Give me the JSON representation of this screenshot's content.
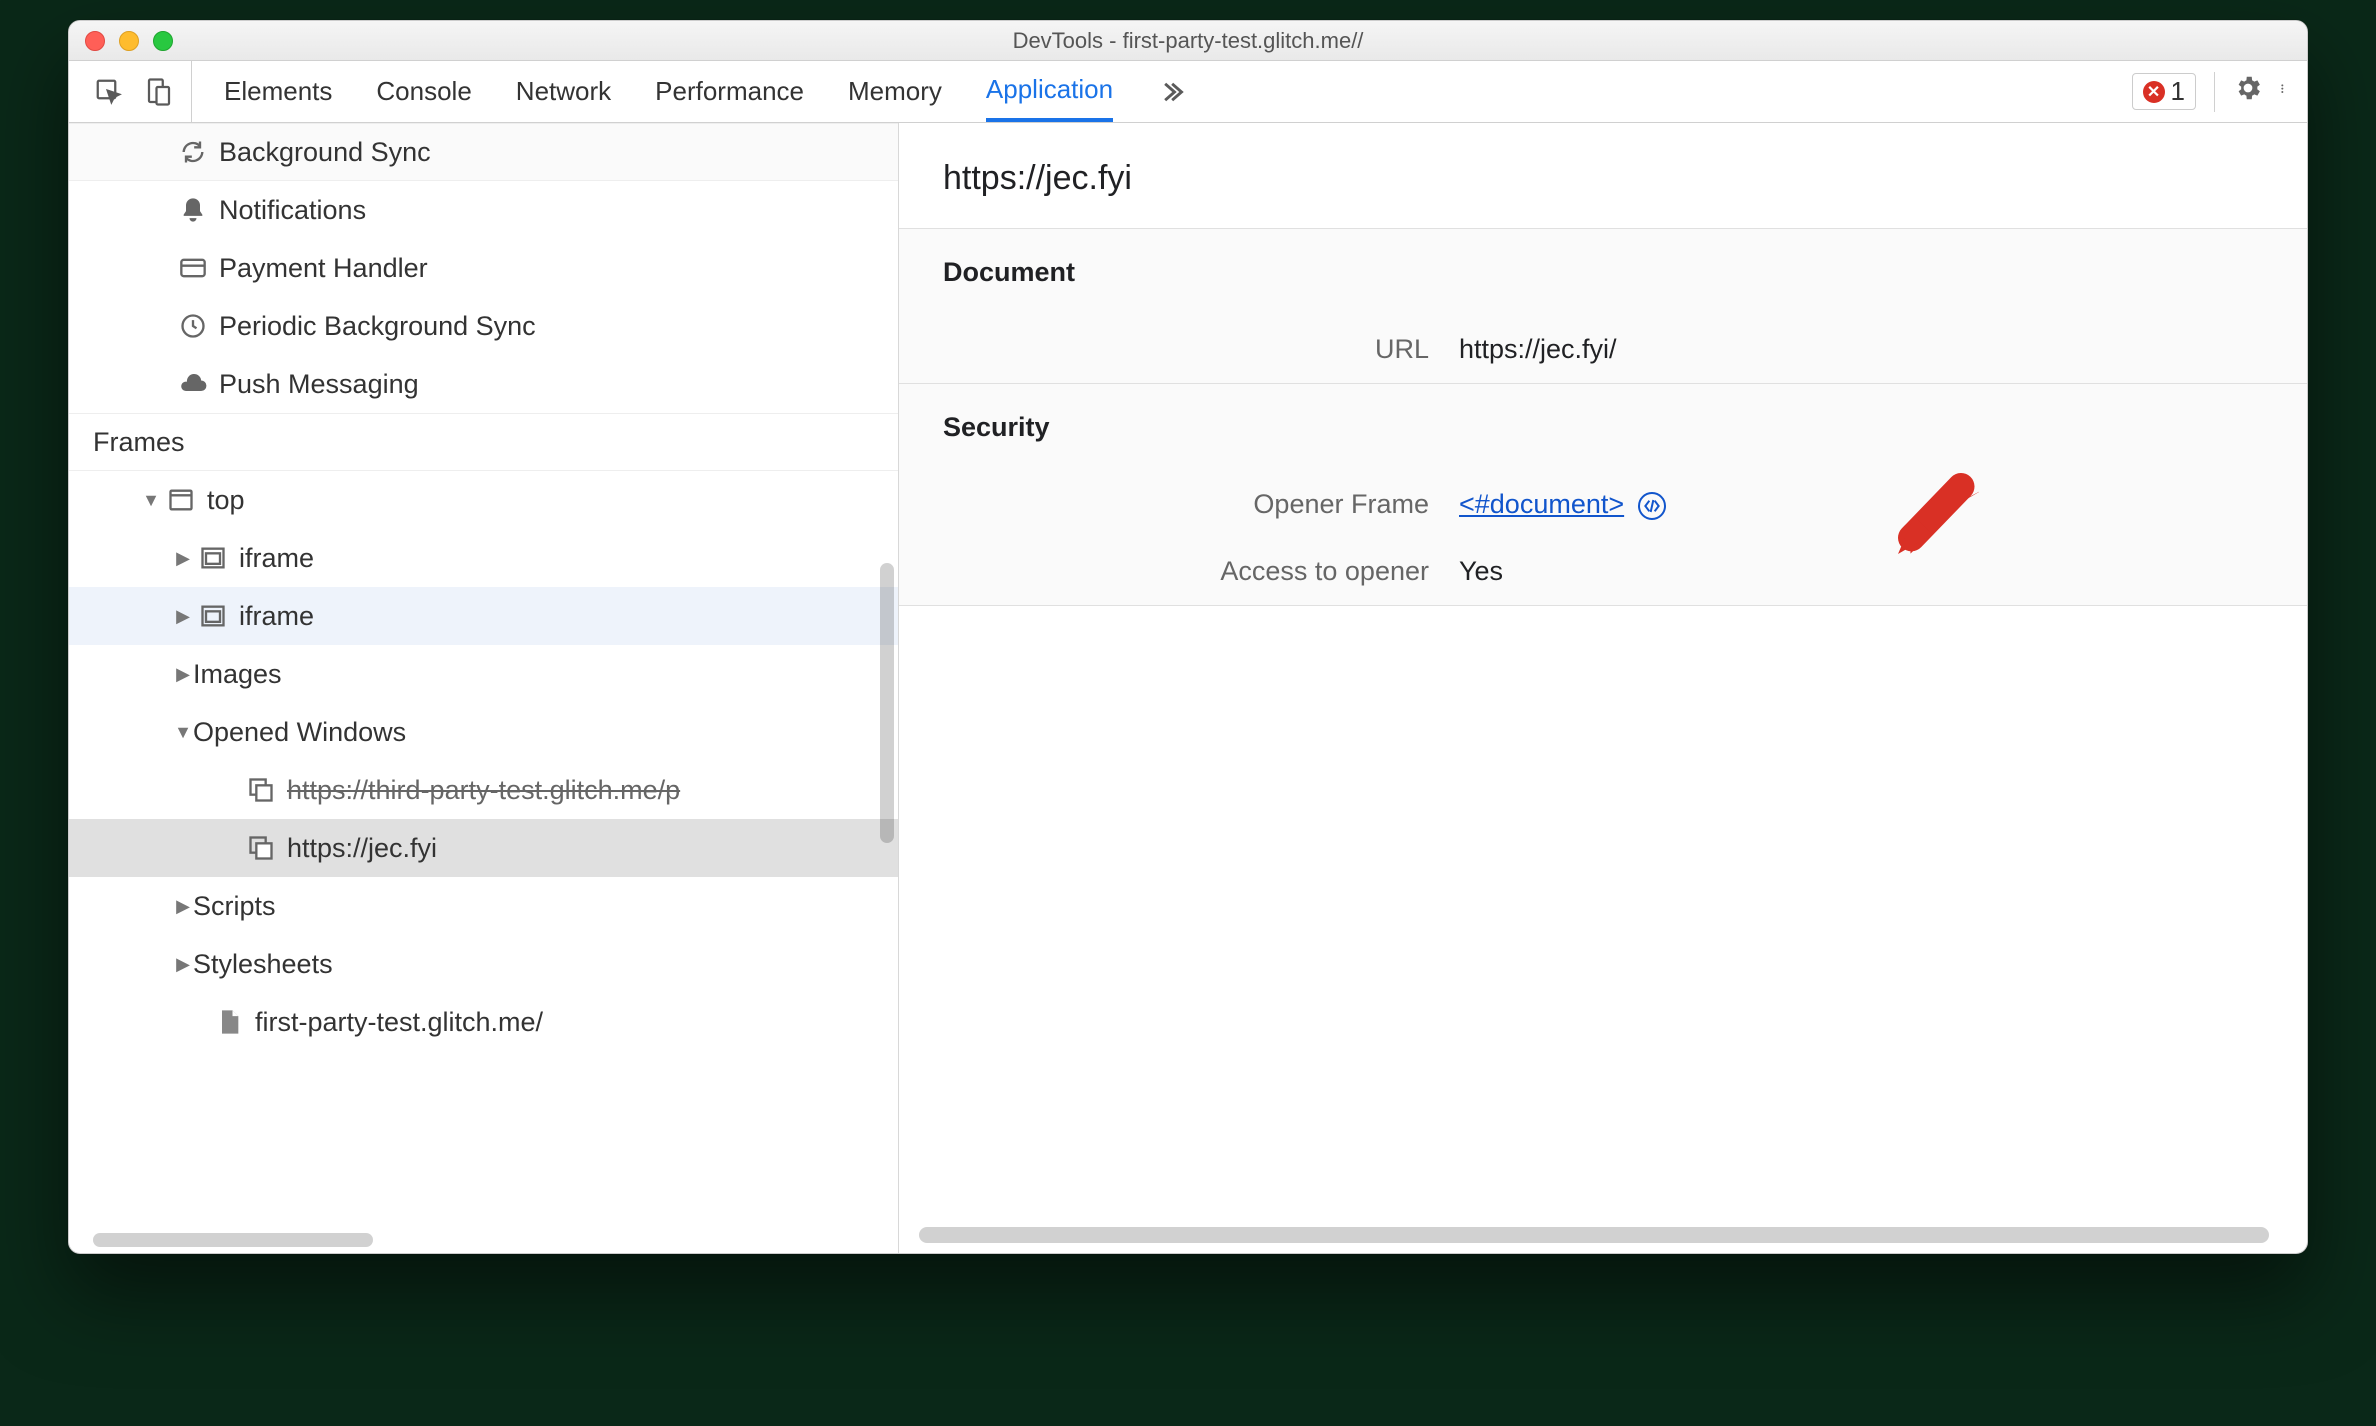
{
  "window": {
    "title": "DevTools - first-party-test.glitch.me//"
  },
  "toolbar": {
    "tabs": [
      "Elements",
      "Console",
      "Network",
      "Performance",
      "Memory",
      "Application"
    ],
    "activeTab": "Application",
    "errorCount": "1"
  },
  "sidebar": {
    "bgItems": [
      {
        "icon": "sync",
        "label": "Background Sync"
      },
      {
        "icon": "bell",
        "label": "Notifications"
      },
      {
        "icon": "card",
        "label": "Payment Handler"
      },
      {
        "icon": "clock",
        "label": "Periodic Background Sync"
      },
      {
        "icon": "cloud",
        "label": "Push Messaging"
      }
    ],
    "framesHeader": "Frames",
    "tree": {
      "top": {
        "label": "top",
        "expanded": true
      },
      "iframe1": {
        "label": "iframe"
      },
      "iframe2": {
        "label": "iframe"
      },
      "images": {
        "label": "Images"
      },
      "opened": {
        "label": "Opened Windows",
        "expanded": true
      },
      "win1": {
        "label": "https://third-party-test.glitch.me/p"
      },
      "win2": {
        "label": "https://jec.fyi"
      },
      "scripts": {
        "label": "Scripts"
      },
      "stylesheets": {
        "label": "Stylesheets"
      },
      "docFile": {
        "label": "first-party-test.glitch.me/"
      }
    }
  },
  "main": {
    "title": "https://jec.fyi",
    "documentSection": "Document",
    "urlLabel": "URL",
    "urlValue": "https://jec.fyi/",
    "securitySection": "Security",
    "openerLabel": "Opener Frame",
    "openerValue": "<#document>",
    "accessLabel": "Access to opener",
    "accessValue": "Yes"
  }
}
